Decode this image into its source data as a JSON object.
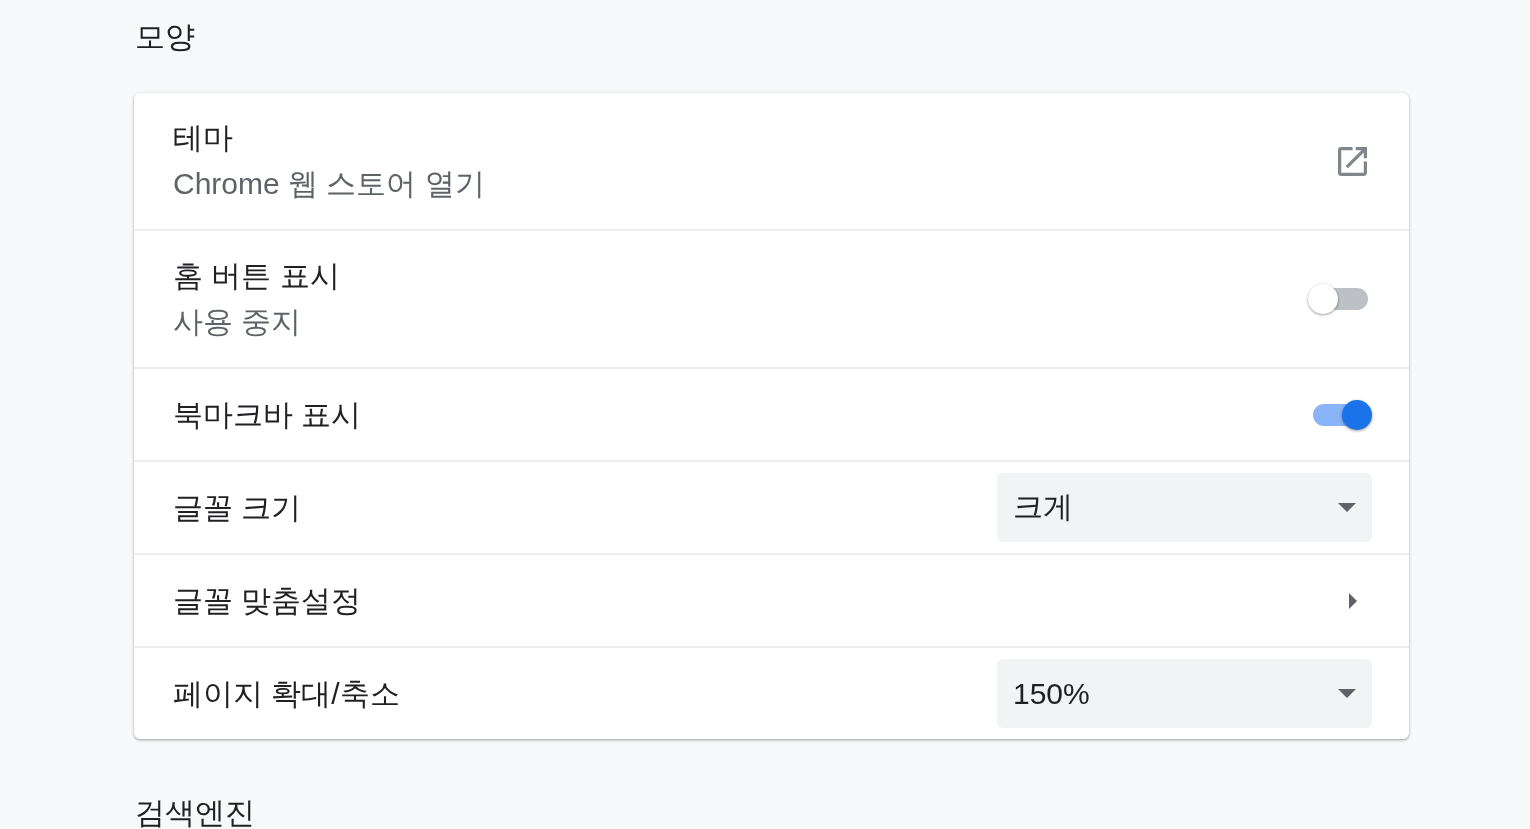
{
  "sections": [
    {
      "title": "모양",
      "rows": [
        {
          "kind": "link",
          "label": "테마",
          "sublabel": "Chrome 웹 스토어 열기"
        },
        {
          "kind": "toggle",
          "label": "홈 버튼 표시",
          "sublabel": "사용 중지",
          "on": false
        },
        {
          "kind": "toggle",
          "label": "북마크바 표시",
          "on": true
        },
        {
          "kind": "select",
          "label": "글꼴 크기",
          "value": "크게"
        },
        {
          "kind": "subpage",
          "label": "글꼴 맞춤설정"
        },
        {
          "kind": "select",
          "label": "페이지 확대/축소",
          "value": "150%"
        }
      ]
    },
    {
      "title": "검색엔진"
    }
  ]
}
